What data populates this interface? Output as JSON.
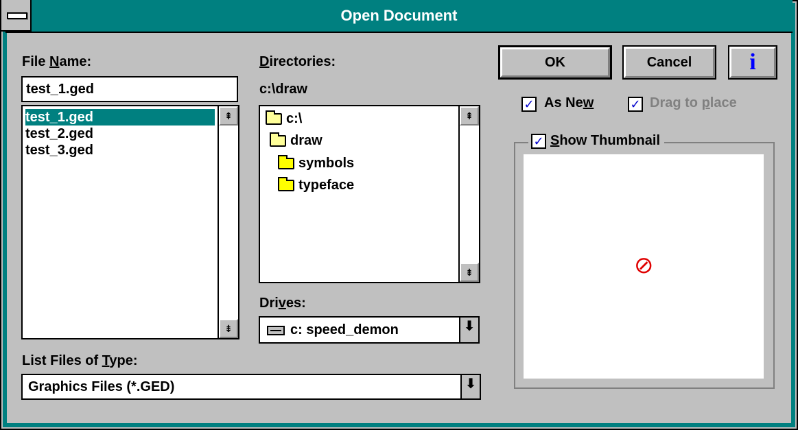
{
  "window": {
    "title": "Open Document"
  },
  "file_name": {
    "label_pre": "File ",
    "label_accel": "N",
    "label_post": "ame:",
    "value": "test_1.ged",
    "files": [
      "test_1.ged",
      "test_2.ged",
      "test_3.ged"
    ],
    "selected": "test_1.ged"
  },
  "directories": {
    "label_accel": "D",
    "label_post": "irectories:",
    "current_path": "c:\\draw",
    "items": [
      "c:\\",
      "draw",
      "symbols",
      "typeface"
    ]
  },
  "drives": {
    "label_pre": "Dri",
    "label_accel": "v",
    "label_post": "es:",
    "selected": "c: speed_demon"
  },
  "file_type": {
    "label_pre": "List Files of ",
    "label_accel": "T",
    "label_post": "ype:",
    "selected": "Graphics Files (*.GED)"
  },
  "buttons": {
    "ok": "OK",
    "cancel": "Cancel",
    "info": "i"
  },
  "options": {
    "as_new_pre": "As Ne",
    "as_new_accel": "w",
    "as_new_checked": true,
    "drag_pre": "Drag to ",
    "drag_accel": "p",
    "drag_post": "lace",
    "drag_checked": true,
    "drag_enabled": false,
    "thumb_accel": "S",
    "thumb_post": "how Thumbnail",
    "thumb_checked": true
  },
  "glyphs": {
    "check": "✓",
    "up": "⇞",
    "down": "⇟",
    "dropdown": "⬇",
    "no_preview": "⊘"
  },
  "icons": [
    "system-menu-icon",
    "folder-icon",
    "drive-icon",
    "info-icon",
    "no-preview-icon"
  ],
  "colors": {
    "title_bar": "#008080",
    "selection": "#008080",
    "check": "#0000cc",
    "info_icon": "#0000ff",
    "no_preview": "#e00000",
    "disabled_text": "#808080"
  }
}
